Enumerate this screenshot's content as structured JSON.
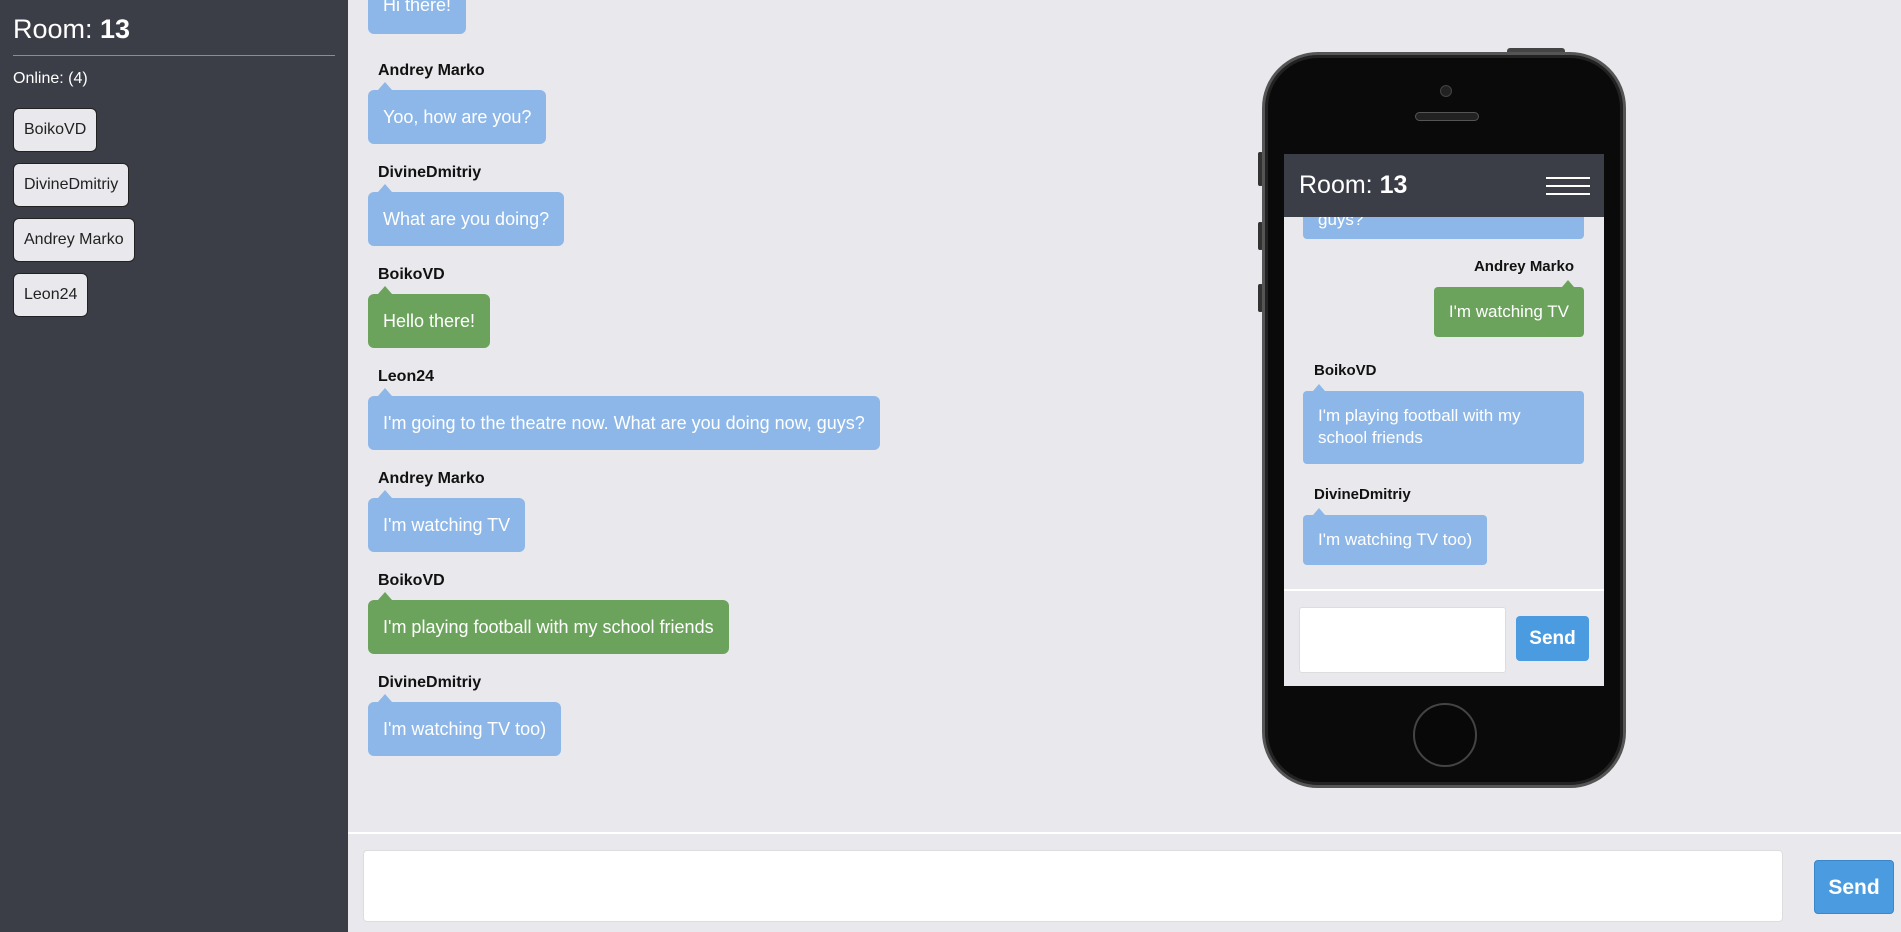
{
  "sidebar": {
    "room_label": "Room: ",
    "room_number": "13",
    "online_text": "Online: (4)",
    "users": [
      "BoikoVD",
      "DivineDmitriy",
      "Andrey Marko",
      "Leon24"
    ]
  },
  "messages": [
    {
      "author": "",
      "text": "Hi there!",
      "own": false
    },
    {
      "author": "Andrey Marko",
      "text": "Yoo, how are you?",
      "own": false
    },
    {
      "author": "DivineDmitriy",
      "text": "What are you doing?",
      "own": false
    },
    {
      "author": "BoikoVD",
      "text": "Hello there!",
      "own": true
    },
    {
      "author": "Leon24",
      "text": "I'm going to the theatre now. What are you doing now, guys?",
      "own": false
    },
    {
      "author": "Andrey Marko",
      "text": "I'm watching TV",
      "own": false
    },
    {
      "author": "BoikoVD",
      "text": "I'm playing football with my school friends",
      "own": true
    },
    {
      "author": "DivineDmitriy",
      "text": "I'm watching TV too)",
      "own": false
    }
  ],
  "composer": {
    "send_label": "Send"
  },
  "phone": {
    "room_label": "Room: ",
    "room_number": "13",
    "partial_text": "guys?",
    "messages": [
      {
        "author": "Andrey Marko",
        "text": "I'm watching TV"
      },
      {
        "author": "BoikoVD",
        "text_line1": "I'm playing football with my",
        "text_line2": "school friends"
      },
      {
        "author": "DivineDmitriy",
        "text": "I'm watching TV too)"
      }
    ],
    "send_label": "Send"
  },
  "colors": {
    "sidebar_bg": "#3b3d47",
    "bubble_blue": "#8db7e8",
    "bubble_green": "#6ca35c",
    "send_button": "#4a9be0",
    "page_bg": "#e9e9ed"
  }
}
